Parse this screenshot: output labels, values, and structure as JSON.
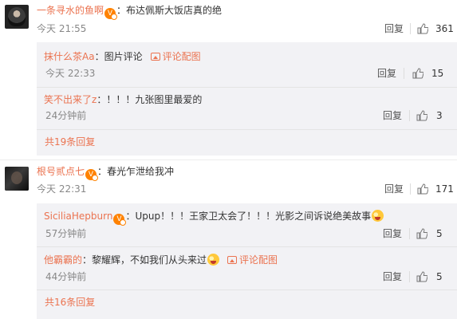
{
  "actions": {
    "reply": "回复"
  },
  "comments": [
    {
      "username": "一条寻水的鱼啊",
      "content": "：布达佩斯大饭店真的绝",
      "time": "今天 21:55",
      "likes": "361",
      "replies": [
        {
          "username": "抹什么茶Aa",
          "content": "：图片评论",
          "pic_label": "评论配图",
          "time": "今天 22:33",
          "likes": "15"
        },
        {
          "username": "笑不出来了z",
          "content": "：！！！九张图里最爱的",
          "time": "24分钟前",
          "likes": "3"
        }
      ],
      "more": "共19条回复"
    },
    {
      "username": "根号贰点七",
      "content": "：春光乍泄给我冲",
      "time": "今天 22:31",
      "likes": "171",
      "replies": [
        {
          "username": "SiciliaHepburn",
          "content": "：Upup！！！王家卫太会了！！！光影之间诉说绝美故事",
          "time": "57分钟前",
          "likes": "5"
        },
        {
          "username": "他霸霸的",
          "content": "：黎耀辉，不如我们从头来过",
          "pic_label": "评论配图",
          "time": "44分钟前",
          "likes": "5"
        }
      ],
      "more": "共16条回复"
    }
  ],
  "colors": {
    "username": "#eb7350",
    "reply_bg": "#f2f2f5",
    "vip": "#ff8200"
  }
}
